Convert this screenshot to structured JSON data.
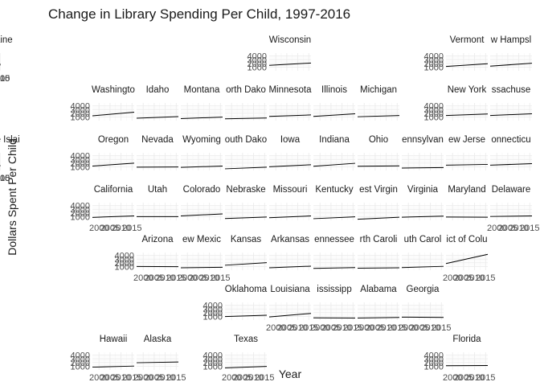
{
  "chart_data": {
    "type": "line",
    "title": "Change in Library Spending Per Child, 1997-2016",
    "xlabel": "Year",
    "ylabel": "Dollars Spent Per Child",
    "xlim": [
      1997,
      2016
    ],
    "ylim": [
      0,
      4800
    ],
    "x_ticks": [
      2000,
      2005,
      2010,
      2015
    ],
    "y_ticks": [
      1000,
      2000,
      3000,
      4000
    ],
    "grid": true,
    "layout": "facet grid by US state (geographic tile map)",
    "panels": [
      {
        "label": "Wisconsin",
        "values": [
          1480,
          2100
        ]
      },
      {
        "label": "Vermont",
        "values": [
          1180,
          1900
        ]
      },
      {
        "label": "w Hampsl",
        "values": [
          1250,
          2050
        ]
      },
      {
        "label": "Maine",
        "values": [
          1450,
          1950
        ]
      },
      {
        "label": "Washingto",
        "values": [
          1300,
          2300
        ]
      },
      {
        "label": "Idaho",
        "values": [
          650,
          1100
        ]
      },
      {
        "label": "Montana",
        "values": [
          550,
          950
        ]
      },
      {
        "label": "orth Dako",
        "values": [
          500,
          700
        ]
      },
      {
        "label": "Minnesota",
        "values": [
          1150,
          1550
        ]
      },
      {
        "label": "Illinois",
        "values": [
          1150,
          1850
        ]
      },
      {
        "label": "Michigan",
        "values": [
          1050,
          1400
        ]
      },
      {
        "label": "New York",
        "values": [
          1400,
          1800
        ]
      },
      {
        "label": "ssachuse",
        "values": [
          1400,
          1850
        ]
      },
      {
        "label": "Oregon",
        "values": [
          1200,
          2000
        ]
      },
      {
        "label": "Nevada",
        "values": [
          900,
          950
        ]
      },
      {
        "label": "Wyoming",
        "values": [
          850,
          1200
        ]
      },
      {
        "label": "outh Dako",
        "values": [
          450,
          900
        ]
      },
      {
        "label": "Iowa",
        "values": [
          1000,
          1550
        ]
      },
      {
        "label": "Indiana",
        "values": [
          1150,
          1950
        ]
      },
      {
        "label": "Ohio",
        "values": [
          1150,
          1250
        ]
      },
      {
        "label": "ennsylvan",
        "values": [
          650,
          800
        ]
      },
      {
        "label": "ew Jerse",
        "values": [
          1450,
          1650
        ]
      },
      {
        "label": "onnecticu",
        "values": [
          1450,
          1850
        ]
      },
      {
        "label": "hode Islai",
        "values": [
          1150,
          1450
        ]
      },
      {
        "label": "California",
        "values": [
          800,
          1200
        ]
      },
      {
        "label": "Utah",
        "values": [
          1000,
          1000
        ]
      },
      {
        "label": "Colorado",
        "values": [
          1200,
          1750
        ]
      },
      {
        "label": "Nebraske",
        "values": [
          500,
          900
        ]
      },
      {
        "label": "Missouri",
        "values": [
          700,
          1200
        ]
      },
      {
        "label": "Kentucky",
        "values": [
          450,
          950
        ]
      },
      {
        "label": "est Virgin",
        "values": [
          300,
          850
        ]
      },
      {
        "label": "Virginia",
        "values": [
          850,
          1150
        ]
      },
      {
        "label": "Maryland",
        "values": [
          900,
          850
        ]
      },
      {
        "label": "Delaware",
        "values": [
          1050,
          1200
        ]
      },
      {
        "label": "Arizona",
        "values": [
          1000,
          950
        ]
      },
      {
        "label": "ew Mexic",
        "values": [
          650,
          800
        ]
      },
      {
        "label": "Kansas",
        "values": [
          1350,
          2050
        ]
      },
      {
        "label": "Arkansas",
        "values": [
          650,
          1100
        ]
      },
      {
        "label": "ennessee",
        "values": [
          500,
          700
        ]
      },
      {
        "label": "rth Caroli",
        "values": [
          550,
          650
        ]
      },
      {
        "label": "uth Carol",
        "values": [
          700,
          1050
        ]
      },
      {
        "label": "ict of Colu",
        "values": [
          1800,
          4300
        ]
      },
      {
        "label": "Oklahoma",
        "values": [
          950,
          1300
        ]
      },
      {
        "label": "Louisiana",
        "values": [
          850,
          1800
        ]
      },
      {
        "label": "ississipp",
        "values": [
          600,
          550
        ]
      },
      {
        "label": "Alabama",
        "values": [
          550,
          700
        ]
      },
      {
        "label": "Georgia",
        "values": [
          800,
          700
        ]
      },
      {
        "label": "Hawaii",
        "values": [
          750,
          1050
        ]
      },
      {
        "label": "Alaska",
        "values": [
          1950,
          2150
        ]
      },
      {
        "label": "Texas",
        "values": [
          550,
          950
        ]
      },
      {
        "label": "Florida",
        "values": [
          1150,
          1200
        ]
      }
    ]
  }
}
